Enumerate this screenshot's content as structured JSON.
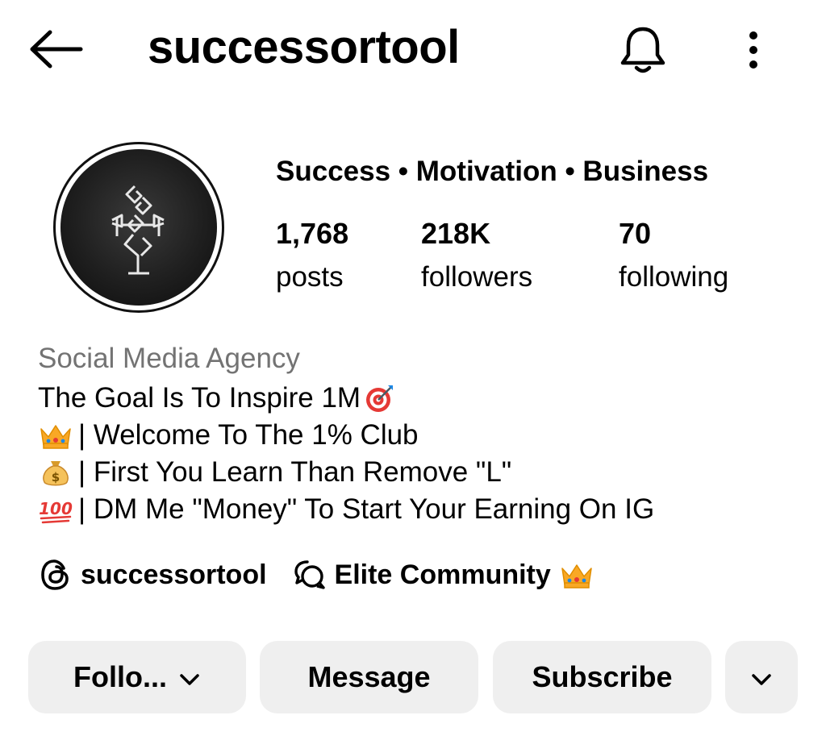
{
  "header": {
    "username": "successortool",
    "icons": [
      "back-arrow-icon",
      "bell-icon",
      "more-vertical-icon"
    ]
  },
  "profile": {
    "avatar_icon": "logo-icon",
    "category": "Success • Motivation • Business",
    "stats": {
      "posts": {
        "count": "1,768",
        "label": "posts"
      },
      "followers": {
        "count": "218K",
        "label": "followers"
      },
      "following": {
        "count": "70",
        "label": "following"
      }
    }
  },
  "bio": {
    "type": "Social Media Agency",
    "lines": [
      {
        "emoji": "target-emoji",
        "text": "The Goal Is To Inspire 1M"
      },
      {
        "emoji": "crown-emoji",
        "text": " | Welcome To The 1% Club"
      },
      {
        "emoji": "money-bag-emoji",
        "text": " | First You Learn Than Remove \"L\""
      },
      {
        "emoji": "hundred-points-emoji",
        "text": " | DM Me \"Money\" To Start Your Earning On IG"
      }
    ]
  },
  "links": {
    "threads": {
      "icon": "threads-icon",
      "label": "successortool"
    },
    "community": {
      "icon": "chat-bubbles-icon",
      "label": "Elite Community",
      "emoji": "crown-emoji"
    }
  },
  "buttons": {
    "follow": "Follo...",
    "message": "Message",
    "subscribe": "Subscribe",
    "more_icon": "chevron-down-icon"
  }
}
